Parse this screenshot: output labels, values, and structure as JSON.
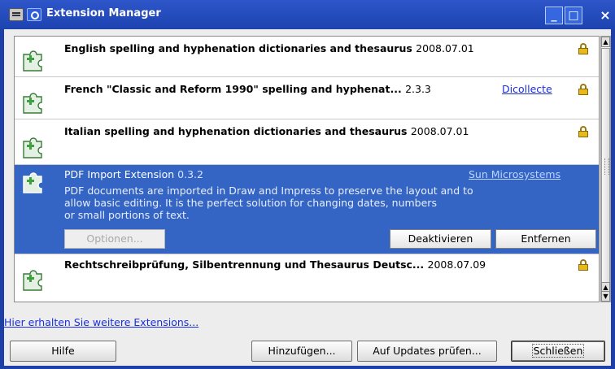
{
  "window": {
    "title": "Extension Manager",
    "min_glyph": "_",
    "max_glyph": "□",
    "close_glyph": "×"
  },
  "extensions": [
    {
      "name": "English spelling and hyphenation dictionaries and thesaurus",
      "version": "2008.07.01",
      "locked": true
    },
    {
      "name": "French \"Classic and Reform 1990\" spelling and hyphenat...",
      "version": "2.3.3",
      "link": "Dicollecte",
      "locked": true
    },
    {
      "name": "Italian spelling and hyphenation dictionaries and thesaurus",
      "version": "2008.07.01",
      "locked": true
    },
    {
      "name": "PDF Import Extension",
      "version": "0.3.2",
      "link": "Sun Microsystems",
      "selected": true,
      "description": [
        "PDF documents are imported in Draw and Impress to preserve the layout and to",
        "allow basic editing. It is the perfect solution for changing dates, numbers",
        "or small portions of text."
      ],
      "options_label": "Optionen...",
      "deactivate_label": "Deaktivieren",
      "remove_label": "Entfernen"
    },
    {
      "name": "Rechtschreibprüfung, Silbentrennung und Thesaurus Deutsc...",
      "version": "2008.07.09",
      "locked": true
    }
  ],
  "more_link": "Hier erhalten Sie weitere Extensions...",
  "buttons": {
    "help": "Hilfe",
    "add": "Hinzufügen...",
    "updates": "Auf Updates prüfen...",
    "close": "Schließen"
  },
  "colors": {
    "titlebar": "#1d43b0",
    "selection": "#3465c4",
    "link": "#1a2ee0"
  }
}
